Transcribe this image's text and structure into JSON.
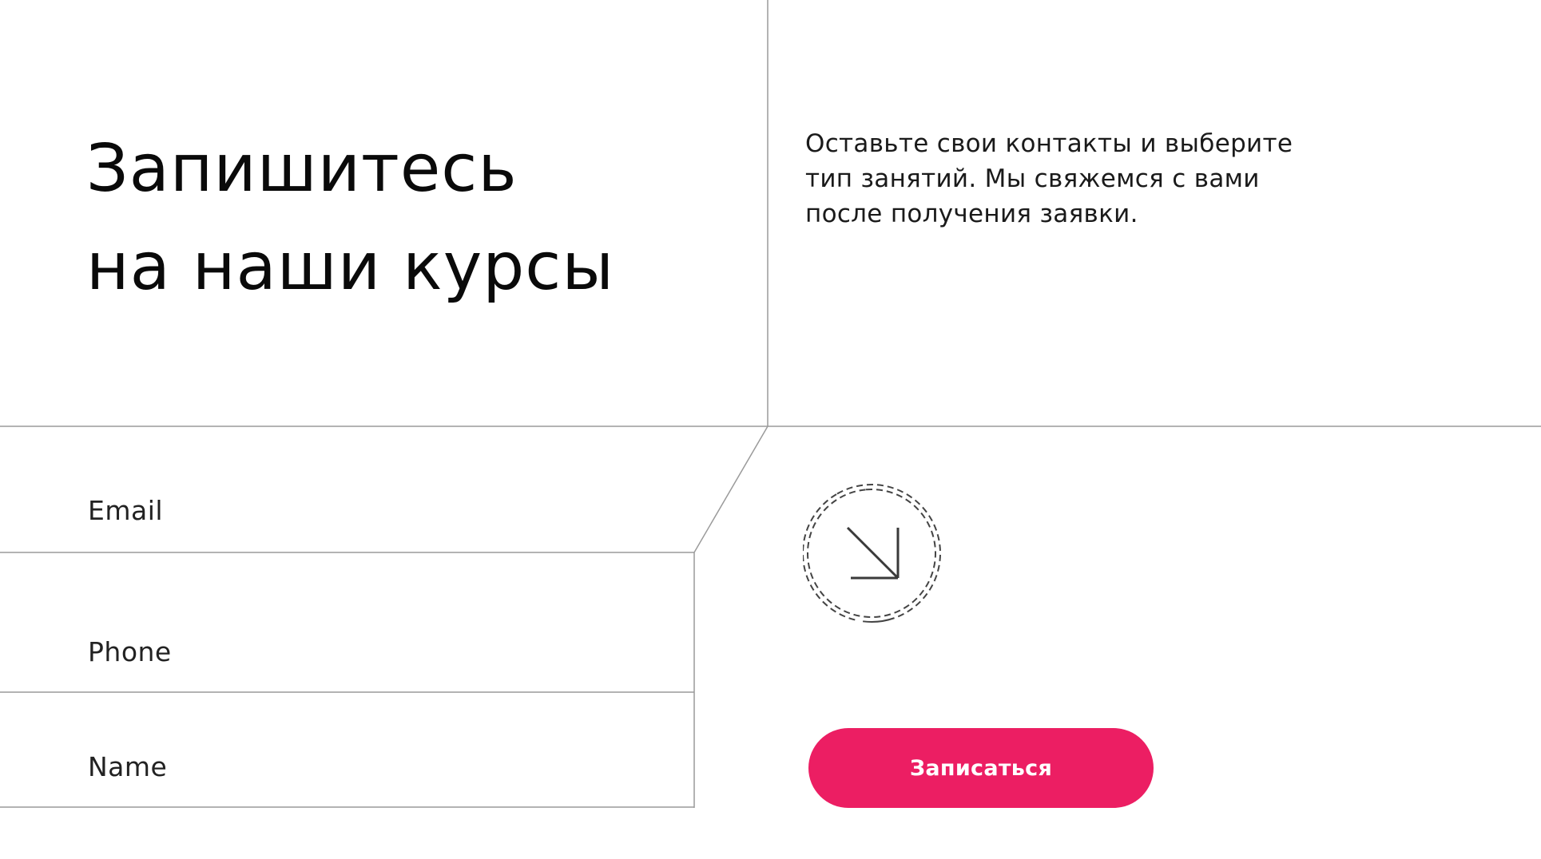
{
  "heading": {
    "line1": "Запишитесь",
    "line2": "на наши курсы"
  },
  "description": {
    "line1": "Оставьте свои контакты и выберите",
    "line2": "тип занятий. Мы свяжемся с вами",
    "line3": "после получения заявки."
  },
  "form": {
    "email_label": "Email",
    "phone_label": "Phone",
    "name_label": "Name",
    "submit_label": "Записаться"
  },
  "icons": {
    "scroll_indicator": "arrow-down-right-icon"
  },
  "colors": {
    "accent": "#EC1E63",
    "line": "#9a9a9a",
    "text": "#111111",
    "background": "#ffffff"
  }
}
